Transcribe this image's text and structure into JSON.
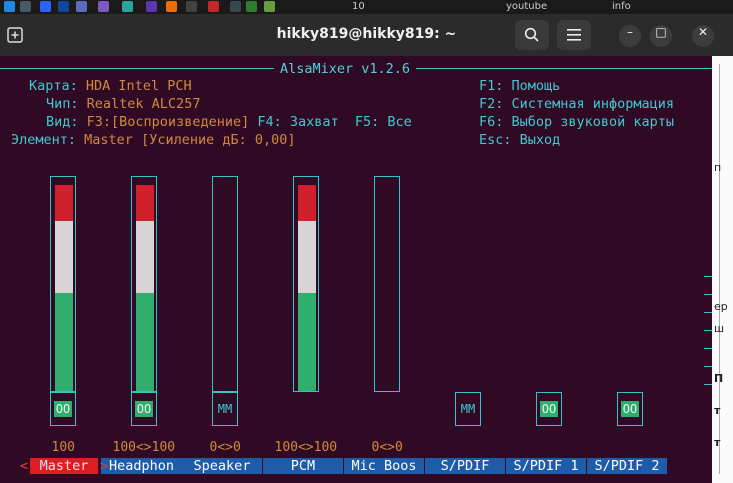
{
  "topbar": {
    "items": [
      {
        "icon": "app-icon-1",
        "color": "#1e88e5"
      },
      {
        "icon": "app-icon-2",
        "color": "#455a64"
      },
      {
        "icon": "app-icon-3",
        "color": "#2962ff"
      },
      {
        "icon": "app-icon-4",
        "color": "#0d47a1"
      },
      {
        "icon": "app-icon-5",
        "color": "#5c6bc0"
      },
      {
        "icon": "app-icon-6",
        "color": "#7e57c2"
      },
      {
        "icon": "app-icon-7",
        "color": "#26a69a"
      },
      {
        "icon": "app-icon-8",
        "color": "#5e35b1"
      },
      {
        "icon": "app-icon-9",
        "color": "#ef6c00"
      },
      {
        "icon": "app-icon-10",
        "color": "#424242"
      },
      {
        "icon": "app-icon-11",
        "color": "#c62828"
      },
      {
        "icon": "app-icon-12",
        "color": "#37474f"
      },
      {
        "icon": "app-icon-13",
        "color": "#2e7d32"
      },
      {
        "icon": "app-icon-14",
        "color": "#689f38"
      }
    ],
    "count_label": "10",
    "bookmark1": "youtube",
    "bookmark2": "info"
  },
  "window": {
    "title": "hikky819@hikky819: ~",
    "newtab_icon": "new-tab-icon",
    "search_icon": "search-icon",
    "menu_icon": "hamburger-menu-icon",
    "minimize": "–",
    "maximize": "□",
    "close": "✕"
  },
  "alsamixer": {
    "frame_title": "AlsaMixer v1.2.6",
    "card_label": "Карта:",
    "card_value": "HDA Intel PCH",
    "chip_label": "Чип:",
    "chip_value": "Realtek ALC257",
    "view_label": "Вид:",
    "view_value": "F3:[Воспроизведение]",
    "view_capture": "F4: Захват",
    "view_all": "F5: Все",
    "element_label": "Элемент:",
    "element_value": "Master [Усиление дБ: 0,00]",
    "help": [
      "F1: Помощь",
      "F2: Системная информация",
      "F6: Выбор звуковой карты",
      "Esc: Выход"
    ]
  },
  "channels": [
    {
      "name": "Master",
      "selected": true,
      "has_bar": true,
      "level": 1.0,
      "mute": "OO",
      "value": "100"
    },
    {
      "name": "Headphon",
      "selected": false,
      "has_bar": true,
      "level": 1.0,
      "mute": "OO",
      "value": "100<>100"
    },
    {
      "name": "Speaker",
      "selected": false,
      "has_bar": true,
      "level": 0.0,
      "mute": "MM",
      "value": "0<>0"
    },
    {
      "name": "PCM",
      "selected": false,
      "has_bar": true,
      "level": 1.0,
      "mute": "",
      "value": "100<>100"
    },
    {
      "name": "Mic Boos",
      "selected": false,
      "has_bar": true,
      "level": 0.0,
      "mute": "",
      "value": "0<>0"
    },
    {
      "name": "S/PDIF",
      "selected": false,
      "has_bar": false,
      "level": 0.0,
      "mute": "MM",
      "value": ""
    },
    {
      "name": "S/PDIF 1",
      "selected": false,
      "has_bar": false,
      "level": 0.0,
      "mute": "OO",
      "value": ""
    },
    {
      "name": "S/PDIF 2",
      "selected": false,
      "has_bar": false,
      "level": 0.0,
      "mute": "OO",
      "value": ""
    }
  ],
  "selector": {
    "left": "<",
    "right": ">"
  },
  "sidepanel": {
    "t1": "п",
    "t2": "ер",
    "t3": "ш",
    "t4": "П",
    "t5": "т",
    "t6": "т"
  },
  "colors": {
    "bar_red": "#d1202d",
    "bar_white": "#d9d4d6",
    "bar_green": "#2fae6e",
    "border": "#36c0c8"
  }
}
